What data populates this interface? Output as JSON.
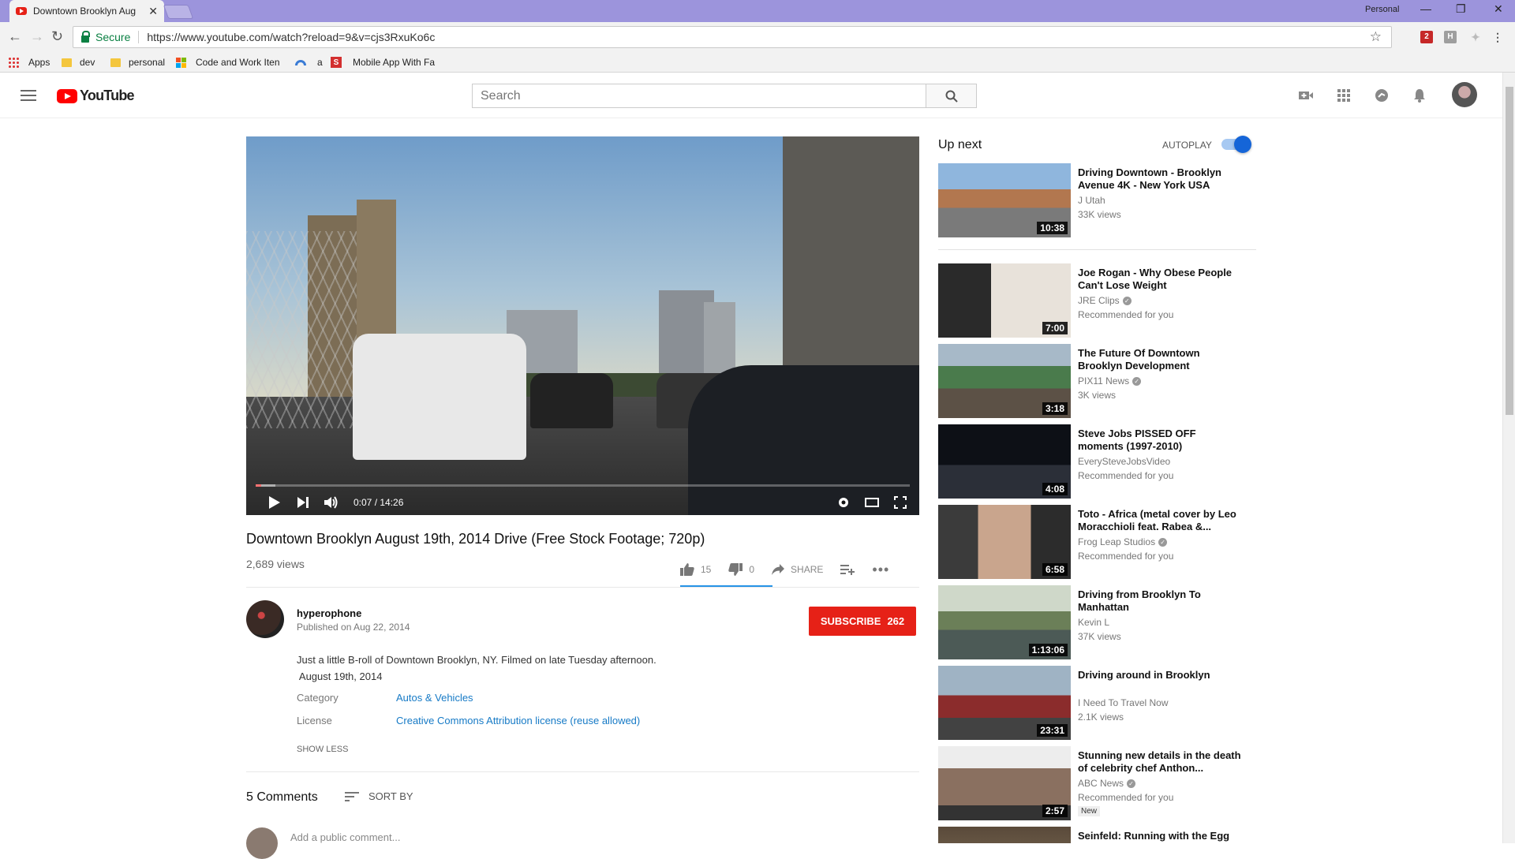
{
  "browser": {
    "tab_title": "Downtown Brooklyn Aug",
    "profile": "Personal",
    "secure_label": "Secure",
    "url": "https://www.youtube.com/watch?reload=9&v=cjs3RxuKo6c",
    "bookmarks": [
      {
        "label": "Apps",
        "icon": "apps-grid-icon"
      },
      {
        "label": "dev",
        "icon": "folder-icon"
      },
      {
        "label": "personal",
        "icon": "folder-icon"
      },
      {
        "label": "Code and Work Iten",
        "icon": "windows-logo-icon"
      },
      {
        "label": "a",
        "icon": "rainbow-icon"
      },
      {
        "label": "Mobile App With Fa",
        "icon": "s-logo-icon"
      }
    ],
    "extension_badge": "2",
    "extension_h": "H"
  },
  "youtube": {
    "logo_text": "YouTube",
    "search_placeholder": "Search"
  },
  "video": {
    "time": "0:07 / 14:26",
    "progress": 0.008,
    "buffered": 0.03,
    "title": "Downtown Brooklyn August 19th, 2014 Drive (Free Stock Footage; 720p)",
    "views": "2,689 views",
    "likes": "15",
    "dislikes": "0",
    "share_label": "SHARE"
  },
  "channel": {
    "name": "hyperophone",
    "published": "Published on Aug 22, 2014",
    "subscribe_label": "SUBSCRIBE",
    "subscriber_count": "262"
  },
  "description": {
    "line1": "Just a little B-roll of Downtown Brooklyn, NY. Filmed on late Tuesday afternoon.",
    "line2": " August 19th, 2014",
    "category_label": "Category",
    "category_value": "Autos & Vehicles",
    "license_label": "License",
    "license_value": "Creative Commons Attribution license (reuse allowed)",
    "show_less": "SHOW LESS"
  },
  "comments": {
    "count_label": "5 Comments",
    "sort_label": "SORT BY",
    "add_placeholder": "Add a public comment..."
  },
  "sidebar": {
    "up_next": "Up next",
    "autoplay": "AUTOPLAY",
    "autoplay_on": true,
    "items": [
      {
        "title": "Driving Downtown - Brooklyn Avenue 4K - New York USA",
        "channel": "J Utah",
        "verified": false,
        "sub": "33K views",
        "duration": "10:38",
        "new": ""
      },
      {
        "title": "Joe Rogan - Why Obese People Can't Lose Weight",
        "channel": "JRE Clips",
        "verified": true,
        "sub": "Recommended for you",
        "duration": "7:00",
        "new": ""
      },
      {
        "title": "The Future Of Downtown Brooklyn Development",
        "channel": "PIX11 News",
        "verified": true,
        "sub": "3K views",
        "duration": "3:18",
        "new": ""
      },
      {
        "title": "Steve Jobs PISSED OFF moments (1997-2010)",
        "channel": "EverySteveJobsVideo",
        "verified": false,
        "sub": "Recommended for you",
        "duration": "4:08",
        "new": ""
      },
      {
        "title": "Toto - Africa (metal cover by Leo Moracchioli feat. Rabea &...",
        "channel": "Frog Leap Studios",
        "verified": true,
        "sub": "Recommended for you",
        "duration": "6:58",
        "new": ""
      },
      {
        "title": "Driving from Brooklyn To Manhattan",
        "channel": "Kevin L",
        "verified": false,
        "sub": "37K views",
        "duration": "1:13:06",
        "new": ""
      },
      {
        "title": "Driving around in Brooklyn",
        "channel": "I Need To Travel Now",
        "verified": false,
        "sub": "2.1K views",
        "duration": "23:31",
        "new": ""
      },
      {
        "title": "Stunning new details in the death of celebrity chef Anthon...",
        "channel": "ABC News",
        "verified": true,
        "sub": "Recommended for you",
        "duration": "2:57",
        "new": "New"
      },
      {
        "title": "Seinfeld: Running with the Egg",
        "channel": "",
        "verified": false,
        "sub": "",
        "duration": "",
        "new": ""
      }
    ]
  },
  "colors": {
    "titlebar": "#9c94dc",
    "brand_red": "#ff0000",
    "subscribe_red": "#e62117",
    "link_blue": "#167ac6",
    "toggle_blue": "#1565d8"
  }
}
